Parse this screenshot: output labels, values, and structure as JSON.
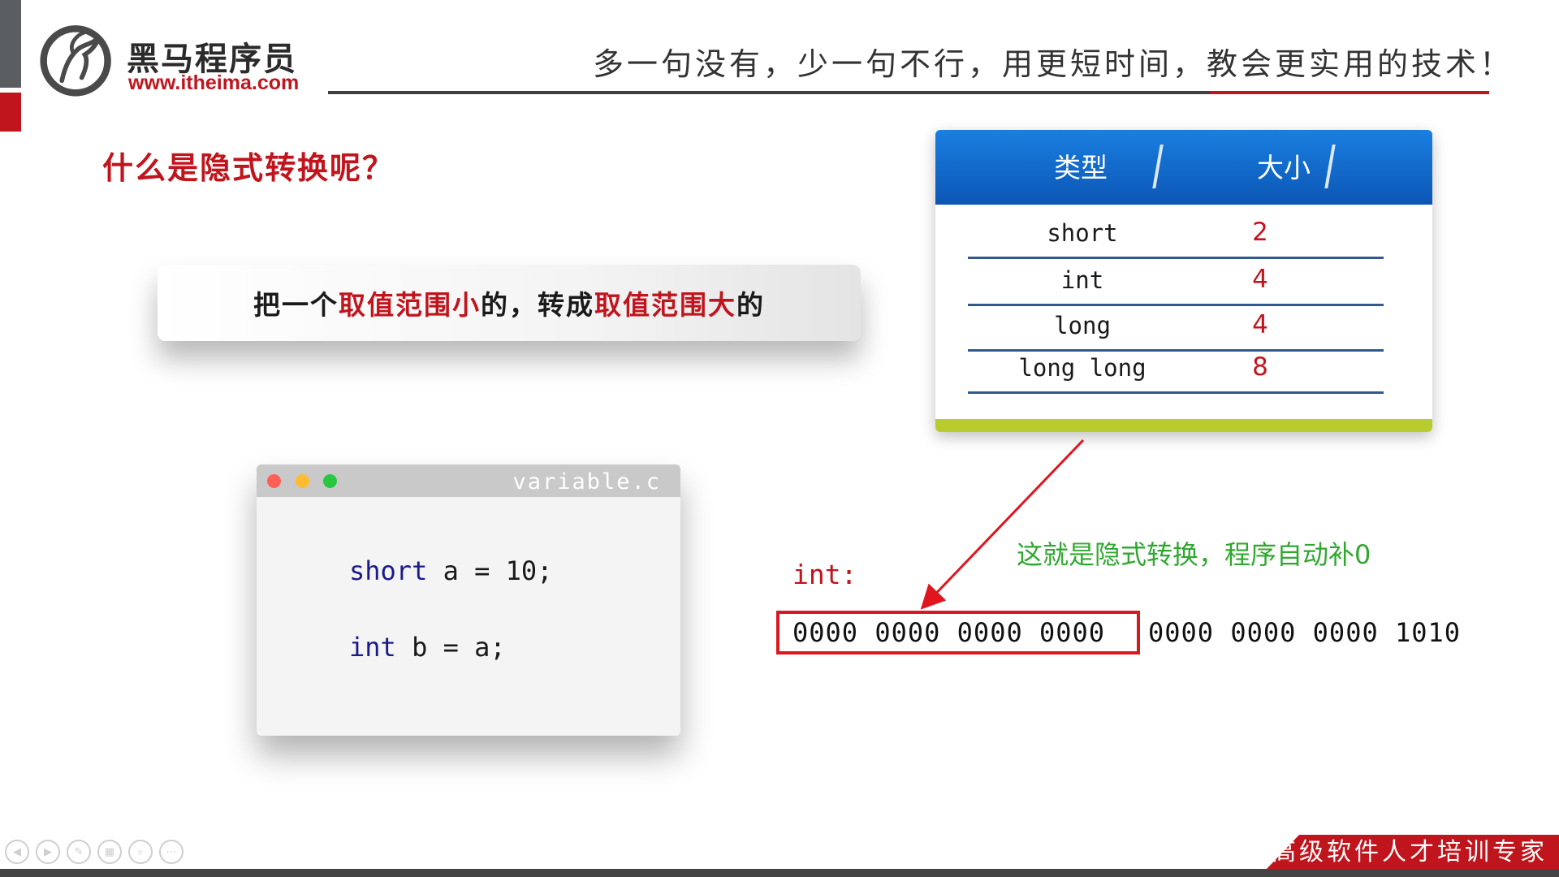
{
  "brand": {
    "name": "黑马程序员",
    "url": "www.itheima.com"
  },
  "header": {
    "slogan": "多一句没有，少一句不行，用更短时间，教会更实用的技术！"
  },
  "question": "什么是隐式转换呢？",
  "definition": {
    "part1": "把一个",
    "part2": "取值范围小",
    "part3": "的，转成",
    "part4": "取值范围大",
    "part5": "的"
  },
  "code_window": {
    "filename": "variable.c",
    "lines": [
      {
        "keyword": "short",
        "rest": " a = 10;"
      },
      {
        "keyword": "int",
        "rest": " b = a;"
      }
    ]
  },
  "type_table": {
    "header_type": "类型",
    "header_size": "大小",
    "rows": [
      {
        "type": "short",
        "size": "2"
      },
      {
        "type": "int",
        "size": "4"
      },
      {
        "type": "long",
        "size": "4"
      },
      {
        "type": "long long",
        "size": "8"
      }
    ]
  },
  "binary": {
    "label": "int:",
    "note": "这就是隐式转换，程序自动补0",
    "high_bits": "0000 0000 0000 0000",
    "low_bits": "0000 0000 0000 1010"
  },
  "footer": {
    "tagline": "高级软件人才培训专家"
  },
  "colors": {
    "accent_red": "#c0151d",
    "table_blue": "#0b56b5",
    "note_green": "#2fa82f",
    "table_footer": "#b8cc2e"
  }
}
